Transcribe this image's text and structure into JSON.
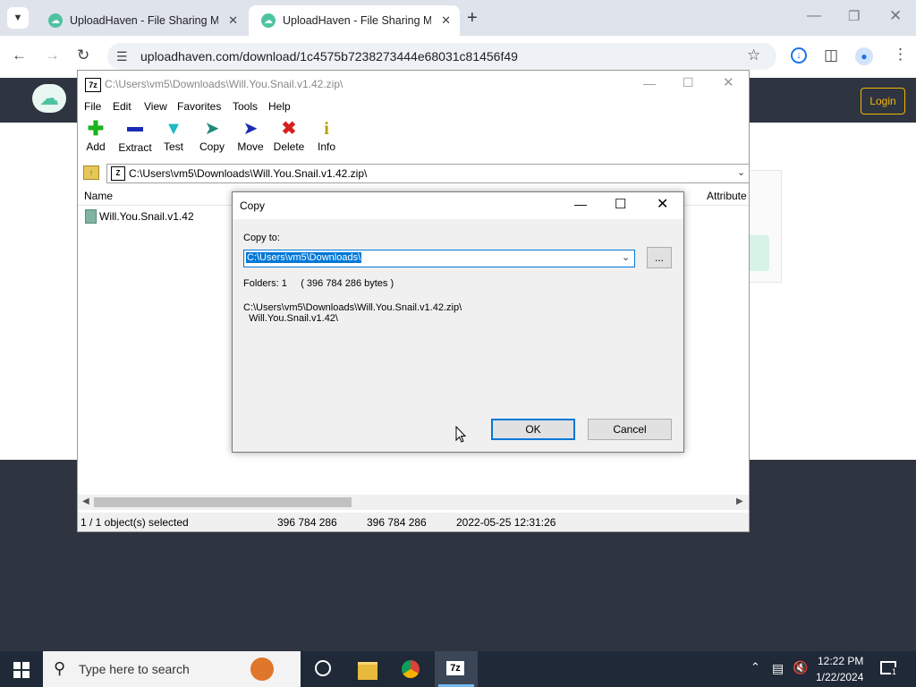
{
  "browser": {
    "tabs": [
      {
        "title": "UploadHaven - File Sharing Ma"
      },
      {
        "title": "UploadHaven - File Sharing Ma"
      }
    ],
    "url": "uploadhaven.com/download/1c4575b7238273444e68031c81456f49"
  },
  "site": {
    "login_label": "Login"
  },
  "sevenzip": {
    "title": "C:\\Users\\vm5\\Downloads\\Will.You.Snail.v1.42.zip\\",
    "app_icon_text": "7z",
    "menu": [
      "File",
      "Edit",
      "View",
      "Favorites",
      "Tools",
      "Help"
    ],
    "toolbar": [
      "Add",
      "Extract",
      "Test",
      "Copy",
      "Move",
      "Delete",
      "Info"
    ],
    "address": "C:\\Users\\vm5\\Downloads\\Will.You.Snail.v1.42.zip\\",
    "columns": {
      "name": "Name",
      "attributes": "Attribute"
    },
    "files": [
      {
        "name": "Will.You.Snail.v1.42"
      }
    ],
    "status": {
      "selected": "1 / 1 object(s) selected",
      "size": "396 784 286",
      "packed": "396 784 286",
      "modified": "2022-05-25 12:31:26"
    }
  },
  "dialog": {
    "title": "Copy",
    "copy_to_label": "Copy to:",
    "copy_to_value": "C:\\Users\\vm5\\Downloads\\",
    "browse_label": "...",
    "info_line": "Folders: 1     ( 396 784 286 bytes )",
    "path_line1": "C:\\Users\\vm5\\Downloads\\Will.You.Snail.v1.42.zip\\",
    "path_line2": "  Will.You.Snail.v1.42\\",
    "ok_label": "OK",
    "cancel_label": "Cancel"
  },
  "taskbar": {
    "search_placeholder": "Type here to search",
    "time": "12:22 PM",
    "date": "1/22/2024",
    "notification_count": "1"
  },
  "colors": {
    "accent_blue": "#0078d7",
    "site_dark": "#2e3440",
    "login_yellow": "#f5b700"
  }
}
